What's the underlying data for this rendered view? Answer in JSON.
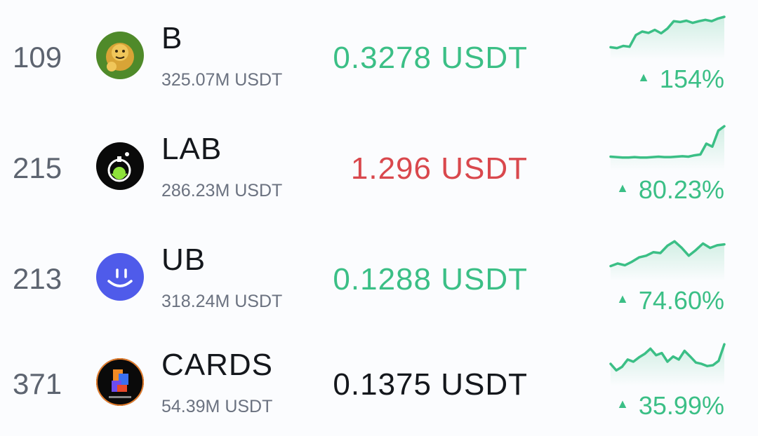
{
  "rows": [
    {
      "rank": "109",
      "symbol": "B",
      "volume": "325.07M USDT",
      "price": "0.3278 USDT",
      "change": "154%",
      "price_color": "#3bbf86",
      "logo": "lion-logo-icon",
      "spark": [
        0.78,
        0.8,
        0.75,
        0.77,
        0.5,
        0.42,
        0.45,
        0.38,
        0.46,
        0.35,
        0.18,
        0.2,
        0.17,
        0.22,
        0.18,
        0.15,
        0.18,
        0.12,
        0.08
      ]
    },
    {
      "rank": "215",
      "symbol": "LAB",
      "volume": "286.23M USDT",
      "price": "1.296 USDT",
      "change": "80.23%",
      "price_color": "#d9484d",
      "logo": "flask-logo-icon",
      "spark": [
        0.75,
        0.76,
        0.77,
        0.77,
        0.76,
        0.77,
        0.77,
        0.76,
        0.75,
        0.76,
        0.76,
        0.75,
        0.74,
        0.75,
        0.72,
        0.7,
        0.45,
        0.52,
        0.15,
        0.05
      ]
    },
    {
      "rank": "213",
      "symbol": "UB",
      "volume": "318.24M USDT",
      "price": "0.1288 USDT",
      "change": "74.60%",
      "price_color": "#3bbf86",
      "logo": "smiley-logo-icon",
      "spark": [
        0.72,
        0.66,
        0.7,
        0.62,
        0.52,
        0.48,
        0.4,
        0.42,
        0.25,
        0.15,
        0.3,
        0.48,
        0.35,
        0.2,
        0.3,
        0.24,
        0.22
      ]
    },
    {
      "rank": "371",
      "symbol": "CARDS",
      "volume": "54.39M USDT",
      "price": "0.1375 USDT",
      "change": "35.99%",
      "price_color": "#14171c",
      "logo": "cards-logo-icon",
      "spark": [
        0.55,
        0.7,
        0.62,
        0.45,
        0.5,
        0.4,
        0.32,
        0.2,
        0.35,
        0.3,
        0.5,
        0.38,
        0.45,
        0.25,
        0.38,
        0.52,
        0.55,
        0.6,
        0.58,
        0.48,
        0.1
      ]
    }
  ]
}
